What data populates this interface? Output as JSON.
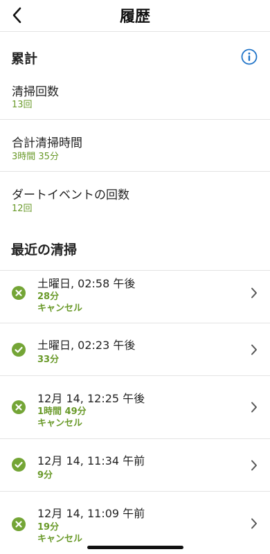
{
  "header": {
    "title": "履歴"
  },
  "summary": {
    "title": "累計",
    "stats": [
      {
        "label": "清掃回数",
        "value": "13回"
      },
      {
        "label": "合計清掃時間",
        "value": "3時間 35分"
      },
      {
        "label": "ダートイベントの回数",
        "value": "12回"
      }
    ]
  },
  "recent": {
    "title": "最近の清掃",
    "items": [
      {
        "when": "土曜日, 02:58 午後",
        "duration": "28分",
        "note": "キャンセル",
        "status": "cancelled"
      },
      {
        "when": "土曜日, 02:23 午後",
        "duration": "33分",
        "note": "",
        "status": "completed"
      },
      {
        "when": "12月 14, 12:25 午後",
        "duration": "1時間 49分",
        "note": "キャンセル",
        "status": "cancelled"
      },
      {
        "when": "12月 14, 11:34 午前",
        "duration": "9分",
        "note": "",
        "status": "completed"
      },
      {
        "when": "12月 14, 11:09 午前",
        "duration": "19分",
        "note": "キャンセル",
        "status": "cancelled"
      }
    ]
  },
  "colors": {
    "accent": "#6a9a2a",
    "status_green": "#74a536",
    "info_blue": "#1e73c8"
  }
}
